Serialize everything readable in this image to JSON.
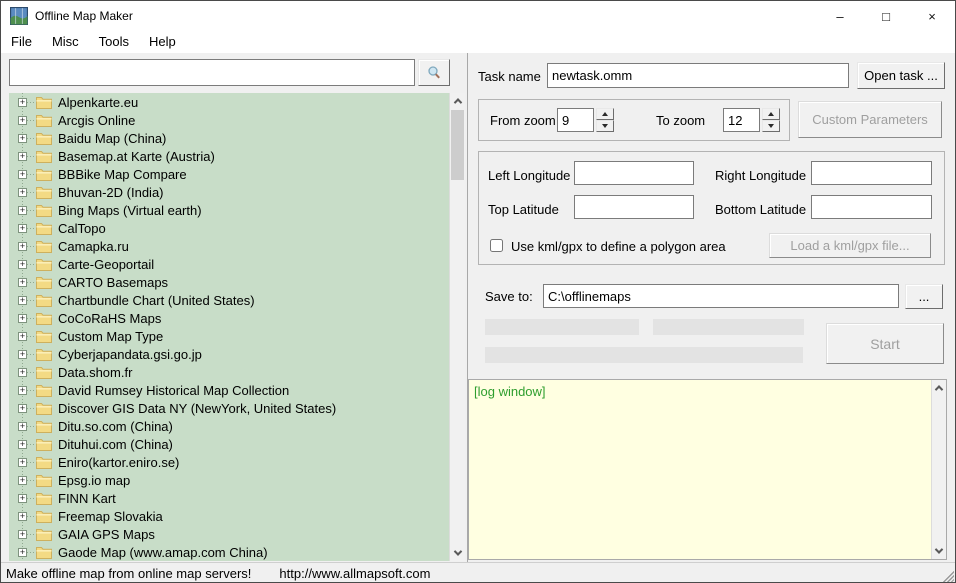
{
  "window": {
    "title": "Offline Map Maker",
    "controls": {
      "minimize": "–",
      "maximize": "□",
      "close": "×"
    }
  },
  "menu": {
    "items": [
      {
        "label": "File"
      },
      {
        "label": "Misc"
      },
      {
        "label": "Tools"
      },
      {
        "label": "Help"
      }
    ]
  },
  "search": {
    "value": ""
  },
  "map_tree": {
    "items": [
      "Alpenkarte.eu",
      "Arcgis Online",
      "Baidu Map (China)",
      "Basemap.at Karte (Austria)",
      "BBBike Map Compare",
      "Bhuvan-2D (India)",
      "Bing Maps (Virtual earth)",
      "CalTopo",
      "Camapka.ru",
      "Carte-Geoportail",
      "CARTO Basemaps",
      "Chartbundle Chart (United States)",
      "CoCoRaHS Maps",
      "Custom Map Type",
      "Cyberjapandata.gsi.go.jp",
      "Data.shom.fr",
      "David Rumsey Historical Map Collection",
      "Discover GIS Data NY (NewYork, United States)",
      "Ditu.so.com (China)",
      "Dituhui.com (China)",
      "Eniro(kartor.eniro.se)",
      "Epsg.io map",
      "FINN Kart",
      "Freemap Slovakia",
      "GAIA GPS Maps",
      "Gaode Map (www.amap.com China)"
    ]
  },
  "task": {
    "label": "Task name",
    "value": "newtask.omm",
    "open_button": "Open task ..."
  },
  "zoom_settings": {
    "from_label": "From zoom",
    "from_value": "9",
    "to_label": "To zoom",
    "to_value": "12",
    "custom_parameters_button": "Custom Parameters"
  },
  "area": {
    "left_longitude_label": "Left Longitude",
    "left_longitude_value": "",
    "right_longitude_label": "Right Longitude",
    "right_longitude_value": "",
    "top_latitude_label": "Top Latitude",
    "top_latitude_value": "",
    "bottom_latitude_label": "Bottom Latitude",
    "bottom_latitude_value": "",
    "kml_checkbox_label": "Use kml/gpx to define a polygon area",
    "kml_checked": false,
    "load_kml_button": "Load a kml/gpx file..."
  },
  "save": {
    "label": "Save to:",
    "path": "C:\\offlinemaps",
    "browse_button": "..."
  },
  "actions": {
    "start_button": "Start"
  },
  "log": {
    "text": "[log window]"
  },
  "status_bar": {
    "tagline": "Make offline map from online map servers!",
    "url": "http://www.allmapsoft.com"
  },
  "colors": {
    "tree_bg": "#c8ddc8",
    "panel_bg": "#f0f0f0",
    "log_bg": "#ffffe1",
    "log_text": "#2e9e2e",
    "folder_icon": "#f3da84"
  }
}
